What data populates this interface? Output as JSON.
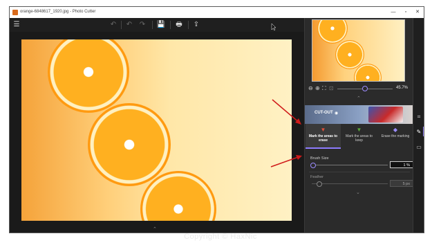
{
  "window": {
    "title": "orange-6848617_1920.jpg - Photo Cutter",
    "controls": {
      "minimize": "—",
      "maximize": "▫",
      "close": "✕"
    }
  },
  "toolbar": {
    "menu_icon": "☰",
    "undo_icon": "↶",
    "back_icon": "↶",
    "redo_icon": "↷",
    "save_icon": "💾",
    "print_icon": "🖶",
    "share_icon": "⇪"
  },
  "canvas": {
    "scroll_indicator": "⌃"
  },
  "zoom": {
    "value": "45.7%",
    "level": 0.45
  },
  "cutout": {
    "label": "CUT-OUT"
  },
  "modes": [
    {
      "label": "Mark the areas to erase",
      "icon": "brush-erase-icon",
      "color": "#e0503a",
      "selected": true
    },
    {
      "label": "Mark the areas to keep",
      "icon": "brush-keep-icon",
      "color": "#5aa83a",
      "selected": false
    },
    {
      "label": "Erase the marking",
      "icon": "eraser-icon",
      "color": "#9c8cff",
      "selected": false
    }
  ],
  "brush": {
    "label": "Brush Size",
    "value": "1 %",
    "level": 0.01
  },
  "feather": {
    "label": "Feather",
    "value": "5 px",
    "level": 0.05
  },
  "rail": {
    "crop_icon": "⌗",
    "brush_icon": "✎",
    "image_icon": "▭"
  },
  "accent": "#8e7cff",
  "watermark": "Copyright © HaxNic"
}
